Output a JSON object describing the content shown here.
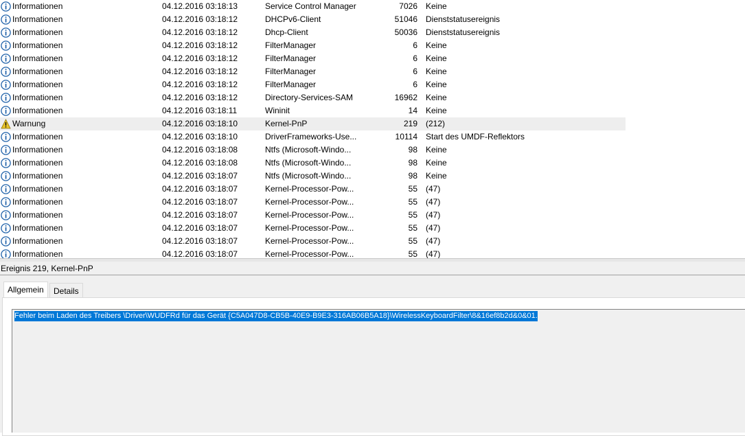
{
  "event_list": {
    "rows": [
      {
        "level": "Informationen",
        "level_icon": "info-icon",
        "datetime": "04.12.2016 03:18:13",
        "source": "Service Control Manager",
        "event_id": "7026",
        "task": "Keine"
      },
      {
        "level": "Informationen",
        "level_icon": "info-icon",
        "datetime": "04.12.2016 03:18:12",
        "source": "DHCPv6-Client",
        "event_id": "51046",
        "task": "Dienststatusereignis"
      },
      {
        "level": "Informationen",
        "level_icon": "info-icon",
        "datetime": "04.12.2016 03:18:12",
        "source": "Dhcp-Client",
        "event_id": "50036",
        "task": "Dienststatusereignis"
      },
      {
        "level": "Informationen",
        "level_icon": "info-icon",
        "datetime": "04.12.2016 03:18:12",
        "source": "FilterManager",
        "event_id": "6",
        "task": "Keine"
      },
      {
        "level": "Informationen",
        "level_icon": "info-icon",
        "datetime": "04.12.2016 03:18:12",
        "source": "FilterManager",
        "event_id": "6",
        "task": "Keine"
      },
      {
        "level": "Informationen",
        "level_icon": "info-icon",
        "datetime": "04.12.2016 03:18:12",
        "source": "FilterManager",
        "event_id": "6",
        "task": "Keine"
      },
      {
        "level": "Informationen",
        "level_icon": "info-icon",
        "datetime": "04.12.2016 03:18:12",
        "source": "FilterManager",
        "event_id": "6",
        "task": "Keine"
      },
      {
        "level": "Informationen",
        "level_icon": "info-icon",
        "datetime": "04.12.2016 03:18:12",
        "source": "Directory-Services-SAM",
        "event_id": "16962",
        "task": "Keine"
      },
      {
        "level": "Informationen",
        "level_icon": "info-icon",
        "datetime": "04.12.2016 03:18:11",
        "source": "Wininit",
        "event_id": "14",
        "task": "Keine"
      },
      {
        "level": "Warnung",
        "level_icon": "warning-icon",
        "datetime": "04.12.2016 03:18:10",
        "source": "Kernel-PnP",
        "event_id": "219",
        "task": "(212)",
        "selected": true
      },
      {
        "level": "Informationen",
        "level_icon": "info-icon",
        "datetime": "04.12.2016 03:18:10",
        "source": "DriverFrameworks-Use...",
        "event_id": "10114",
        "task": "Start des UMDF-Reflektors"
      },
      {
        "level": "Informationen",
        "level_icon": "info-icon",
        "datetime": "04.12.2016 03:18:08",
        "source": "Ntfs (Microsoft-Windo...",
        "event_id": "98",
        "task": "Keine"
      },
      {
        "level": "Informationen",
        "level_icon": "info-icon",
        "datetime": "04.12.2016 03:18:08",
        "source": "Ntfs (Microsoft-Windo...",
        "event_id": "98",
        "task": "Keine"
      },
      {
        "level": "Informationen",
        "level_icon": "info-icon",
        "datetime": "04.12.2016 03:18:07",
        "source": "Ntfs (Microsoft-Windo...",
        "event_id": "98",
        "task": "Keine"
      },
      {
        "level": "Informationen",
        "level_icon": "info-icon",
        "datetime": "04.12.2016 03:18:07",
        "source": "Kernel-Processor-Pow...",
        "event_id": "55",
        "task": "(47)"
      },
      {
        "level": "Informationen",
        "level_icon": "info-icon",
        "datetime": "04.12.2016 03:18:07",
        "source": "Kernel-Processor-Pow...",
        "event_id": "55",
        "task": "(47)"
      },
      {
        "level": "Informationen",
        "level_icon": "info-icon",
        "datetime": "04.12.2016 03:18:07",
        "source": "Kernel-Processor-Pow...",
        "event_id": "55",
        "task": "(47)"
      },
      {
        "level": "Informationen",
        "level_icon": "info-icon",
        "datetime": "04.12.2016 03:18:07",
        "source": "Kernel-Processor-Pow...",
        "event_id": "55",
        "task": "(47)"
      },
      {
        "level": "Informationen",
        "level_icon": "info-icon",
        "datetime": "04.12.2016 03:18:07",
        "source": "Kernel-Processor-Pow...",
        "event_id": "55",
        "task": "(47)"
      },
      {
        "level": "Informationen",
        "level_icon": "info-icon",
        "datetime": "04.12.2016 03:18:07",
        "source": "Kernel-Processor-Pow...",
        "event_id": "55",
        "task": "(47)"
      }
    ]
  },
  "details": {
    "header": "Ereignis 219, Kernel-PnP",
    "tabs": [
      {
        "label": "Allgemein",
        "active": true
      },
      {
        "label": "Details",
        "active": false
      }
    ],
    "message": "Fehler beim Laden des Treibers \\Driver\\WUDFRd für das Gerät {C5A047D8-CB5B-40E9-B9E3-316AB06B5A18}\\WirelessKeyboardFilter\\8&16ef8b2d&0&01."
  },
  "colors": {
    "selection_highlight": "#0078d7",
    "selected_row": "#eeeeee",
    "info_icon": "#1c5fa8",
    "warning_icon": "#e8c42a"
  }
}
